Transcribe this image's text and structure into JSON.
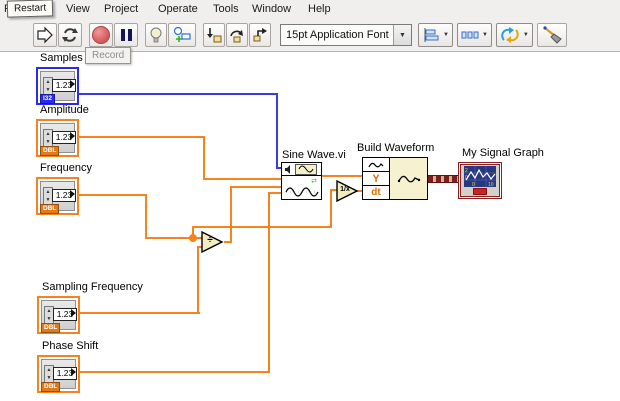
{
  "window": {
    "menu_items": [
      "File",
      "View",
      "Project",
      "Operate",
      "Tools",
      "Window",
      "Help"
    ]
  },
  "tooltips": {
    "restart": "Restart",
    "record": "Record"
  },
  "toolbar": {
    "font_selector": "15pt Application Font"
  },
  "diagram": {
    "controls": [
      {
        "label": "Samples",
        "value": "1.23",
        "type_tag": "I32"
      },
      {
        "label": "Amplitude",
        "value": "1.23",
        "type_tag": "DBL"
      },
      {
        "label": "Frequency",
        "value": "1.23",
        "type_tag": "DBL"
      },
      {
        "label": "Sampling Frequency",
        "value": "1.23",
        "type_tag": "DBL"
      },
      {
        "label": "Phase Shift",
        "value": "1.23",
        "type_tag": "DBL"
      }
    ],
    "functions": {
      "divide_glyph": "÷",
      "reciprocal_glyph": "1/x"
    },
    "nodes": {
      "sine_wave_label": "Sine Wave.vi",
      "build_waveform_label": "Build Waveform",
      "build_waveform_ports": {
        "y": "Y",
        "dt": "dt"
      },
      "graph_label": "My Signal Graph"
    },
    "colors": {
      "dbl_wire": "#f78320",
      "i32_wire": "#3a3ae8",
      "dynamic_wire": "#7a1e1e"
    }
  }
}
